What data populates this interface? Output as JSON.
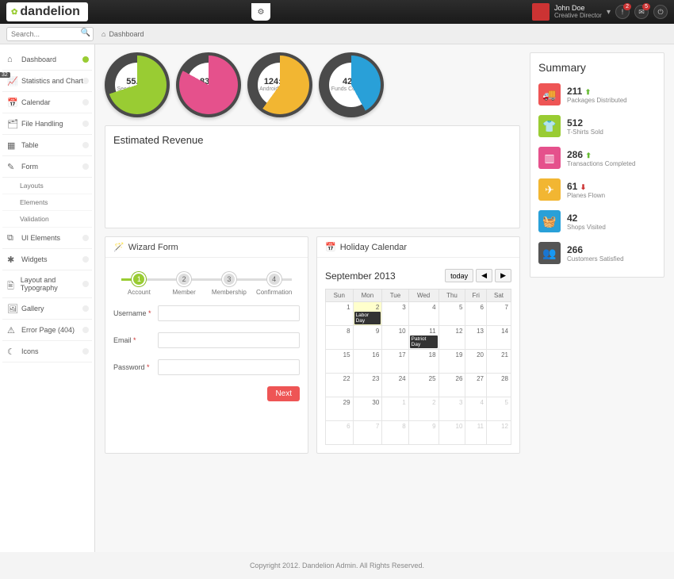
{
  "brand": "dandelion",
  "header": {
    "user_name": "John Doe",
    "user_role": "Creative Director",
    "badge1": "2",
    "badge2": "5"
  },
  "search_placeholder": "Search...",
  "breadcrumb": "Dashboard",
  "sidebar": [
    {
      "icon": "⌂",
      "label": "Dashboard",
      "active": true
    },
    {
      "icon": "📈",
      "label": "Statistics and Charts",
      "badge": "32"
    },
    {
      "icon": "📅",
      "label": "Calendar"
    },
    {
      "icon": "🗂",
      "label": "File Handling"
    },
    {
      "icon": "▦",
      "label": "Table"
    },
    {
      "icon": "✎",
      "label": "Form",
      "sub": [
        "Layouts",
        "Elements",
        "Validation"
      ]
    },
    {
      "icon": "⧉",
      "label": "UI Elements"
    },
    {
      "icon": "✱",
      "label": "Widgets"
    },
    {
      "icon": "🖹",
      "label": "Layout and Typography"
    },
    {
      "icon": "🖼",
      "label": "Gallery"
    },
    {
      "icon": "⚠",
      "label": "Error Page (404)"
    },
    {
      "icon": "☾",
      "label": "Icons"
    }
  ],
  "dials": [
    {
      "value": "55.98",
      "label": "Seeds Collected",
      "color": "#9c3",
      "pct": 70
    },
    {
      "value": "83%",
      "label": "iPads Cloned",
      "color": "#e5518c",
      "pct": 83
    },
    {
      "value": "124:523",
      "label": "Androids Bought",
      "color": "#f2b632",
      "pct": 60
    },
    {
      "value": "42%",
      "label": "Funds Collected",
      "color": "#29a0d8",
      "pct": 42
    }
  ],
  "revenue_title": "Estimated Revenue",
  "summary_title": "Summary",
  "summary": [
    {
      "color": "#e55",
      "icon": "🚚",
      "value": "211",
      "label": "Packages Distributed",
      "trend": "up"
    },
    {
      "color": "#9c3",
      "icon": "👕",
      "value": "512",
      "label": "T-Shirts Sold"
    },
    {
      "color": "#e5518c",
      "icon": "▥",
      "value": "286",
      "label": "Transactions Completed",
      "trend": "up"
    },
    {
      "color": "#f2b632",
      "icon": "✈",
      "value": "61",
      "label": "Planes Flown",
      "trend": "down"
    },
    {
      "color": "#29a0d8",
      "icon": "🧺",
      "value": "42",
      "label": "Shops Visited"
    },
    {
      "color": "#555",
      "icon": "👥",
      "value": "266",
      "label": "Customers Satisfied"
    }
  ],
  "wizard": {
    "title": "Wizard Form",
    "steps": [
      "Account",
      "Member",
      "Membership",
      "Confirmation"
    ],
    "active_step": 0,
    "fields": [
      {
        "label": "Username",
        "required": true
      },
      {
        "label": "Email",
        "required": true
      },
      {
        "label": "Password",
        "required": true
      }
    ],
    "next_label": "Next"
  },
  "calendar": {
    "title": "Holiday Calendar",
    "month": "September 2013",
    "today_label": "today",
    "days": [
      "Sun",
      "Mon",
      "Tue",
      "Wed",
      "Thu",
      "Fri",
      "Sat"
    ],
    "weeks": [
      [
        {
          "n": 1
        },
        {
          "n": 2,
          "hl": true,
          "event": "Labor Day"
        },
        {
          "n": 3
        },
        {
          "n": 4
        },
        {
          "n": 5
        },
        {
          "n": 6
        },
        {
          "n": 7
        }
      ],
      [
        {
          "n": 8
        },
        {
          "n": 9
        },
        {
          "n": 10
        },
        {
          "n": 11,
          "event": "Patriot Day"
        },
        {
          "n": 12
        },
        {
          "n": 13
        },
        {
          "n": 14
        }
      ],
      [
        {
          "n": 15
        },
        {
          "n": 16
        },
        {
          "n": 17
        },
        {
          "n": 18
        },
        {
          "n": 19
        },
        {
          "n": 20
        },
        {
          "n": 21
        }
      ],
      [
        {
          "n": 22
        },
        {
          "n": 23
        },
        {
          "n": 24
        },
        {
          "n": 25
        },
        {
          "n": 26
        },
        {
          "n": 27
        },
        {
          "n": 28
        }
      ],
      [
        {
          "n": 29
        },
        {
          "n": 30
        },
        {
          "n": 1,
          "other": true
        },
        {
          "n": 2,
          "other": true
        },
        {
          "n": 3,
          "other": true
        },
        {
          "n": 4,
          "other": true
        },
        {
          "n": 5,
          "other": true
        }
      ],
      [
        {
          "n": 6,
          "other": true
        },
        {
          "n": 7,
          "other": true
        },
        {
          "n": 8,
          "other": true
        },
        {
          "n": 9,
          "other": true
        },
        {
          "n": 10,
          "other": true
        },
        {
          "n": 11,
          "other": true
        },
        {
          "n": 12,
          "other": true
        }
      ]
    ]
  },
  "footer": "Copyright 2012. Dandelion Admin. All Rights Reserved."
}
